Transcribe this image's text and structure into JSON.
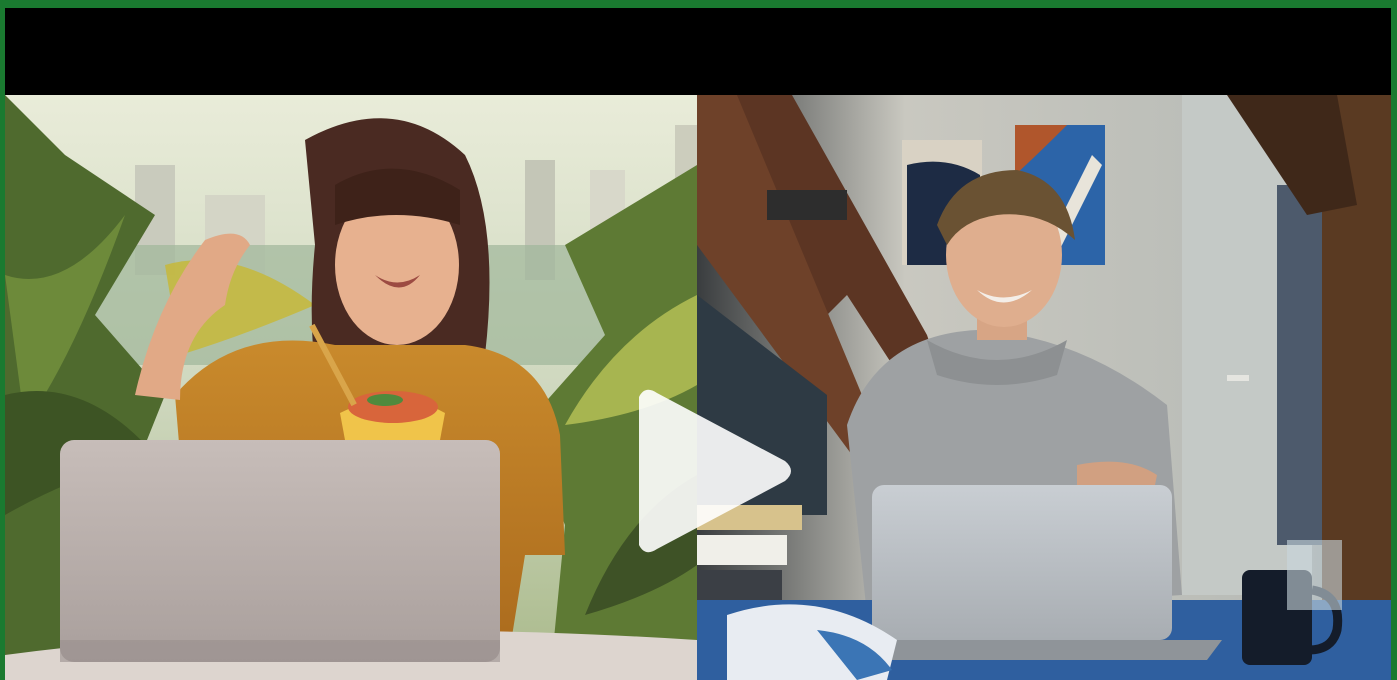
{
  "player": {
    "state": "paused",
    "frame_color": "#1a7a30"
  },
  "icons": {
    "play": "play-icon"
  },
  "scene": {
    "left_panel": "woman-with-laptop-on-balcony",
    "right_panel": "man-with-laptop-at-desk"
  }
}
